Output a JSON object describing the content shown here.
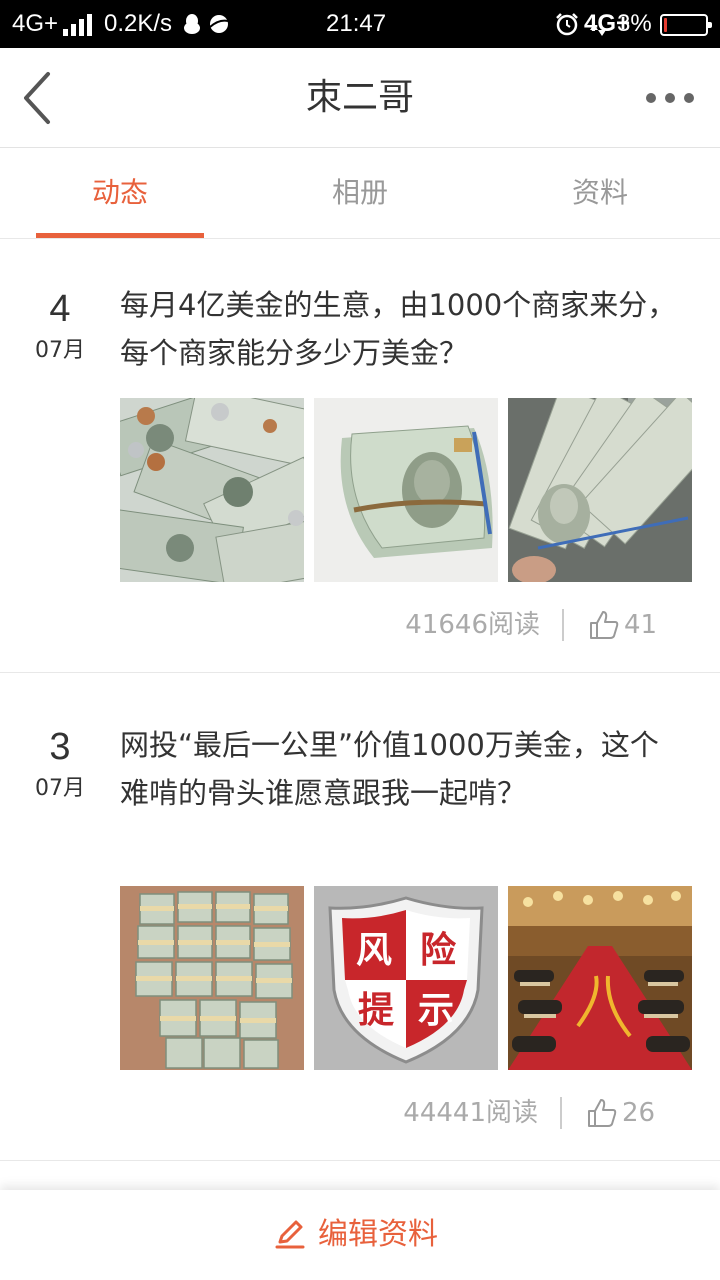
{
  "status_bar": {
    "network": "4G+",
    "speed": "0.2K/s",
    "time": "21:47",
    "network_right": "4G+",
    "battery_text": "3%",
    "battery_level": 0.03,
    "battery_color": "#e43b30"
  },
  "header": {
    "title": "朿二哥"
  },
  "tabs": [
    {
      "label": "动态",
      "active": true
    },
    {
      "label": "相册",
      "active": false
    },
    {
      "label": "资料",
      "active": false
    }
  ],
  "posts": [
    {
      "day": "4",
      "month": "07月",
      "title": "每月4亿美金的生意，由1000个商家来分，每个商家能分多少万美金？",
      "images": [
        "money-pile-image",
        "rolled-100-dollar-bills-image",
        "fanned-100-dollar-bills-image"
      ],
      "reads": "41646阅读",
      "likes": "41"
    },
    {
      "day": "3",
      "month": "07月",
      "title": "网投“最后一公里”价值1000万美金，这个难啃的骨头谁愿意跟我一起啃？",
      "images": [
        "stacked-cash-bundles-image",
        "risk-warning-shield-image",
        "casino-floor-image"
      ],
      "risk_badge": [
        "风",
        "险",
        "提",
        "示"
      ],
      "reads": "44441阅读",
      "likes": "26"
    }
  ],
  "bottom_bar": {
    "edit_label": "编辑资料"
  },
  "colors": {
    "accent": "#e8613c",
    "muted": "#999999",
    "status_bar_bg": "#000000"
  }
}
